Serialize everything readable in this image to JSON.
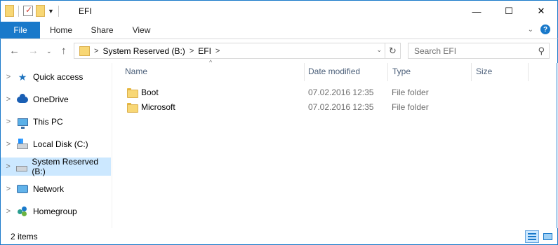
{
  "window": {
    "title": "EFI",
    "minimize_glyph": "—",
    "maximize_glyph": "☐",
    "close_glyph": "✕"
  },
  "ribbon": {
    "tabs": [
      "File",
      "Home",
      "Share",
      "View"
    ],
    "expand_glyph": "⌄",
    "help_glyph": "?"
  },
  "address": {
    "segments": [
      "System Reserved (B:)",
      "EFI"
    ],
    "chevron": ">",
    "search_placeholder": "Search EFI"
  },
  "nav": {
    "back_glyph": "←",
    "forward_glyph": "→",
    "recent_glyph": "⌄",
    "up_glyph": "↑",
    "expand_glyph": ">",
    "items": [
      {
        "label": "Quick access",
        "icon": "star-icon"
      },
      {
        "label": "OneDrive",
        "icon": "cloud-icon"
      },
      {
        "label": "This PC",
        "icon": "computer-icon"
      },
      {
        "label": "Local Disk (C:)",
        "icon": "windows-drive-icon"
      },
      {
        "label": "System Reserved (B:)",
        "icon": "drive-icon",
        "selected": true
      },
      {
        "label": "Network",
        "icon": "network-icon"
      },
      {
        "label": "Homegroup",
        "icon": "homegroup-icon"
      }
    ]
  },
  "columns": {
    "name": "Name",
    "date": "Date modified",
    "type": "Type",
    "size": "Size",
    "sort_glyph": "^"
  },
  "files": [
    {
      "name": "Boot",
      "date": "07.02.2016 12:35",
      "type": "File folder",
      "size": ""
    },
    {
      "name": "Microsoft",
      "date": "07.02.2016 12:35",
      "type": "File folder",
      "size": ""
    }
  ],
  "status": {
    "item_count": "2 items"
  },
  "colors": {
    "accent": "#1979ca",
    "selection": "#cce8ff",
    "folder": "#f8d775"
  }
}
